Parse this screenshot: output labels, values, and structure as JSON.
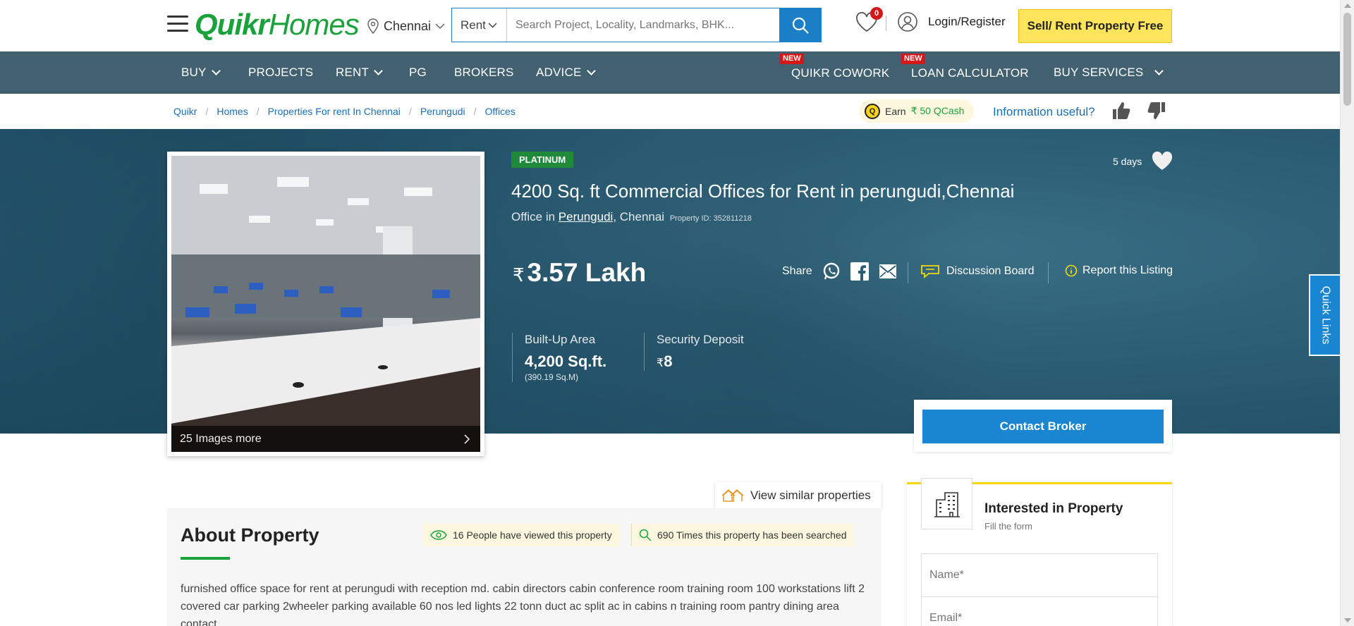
{
  "header": {
    "logo_quikr": "Quikr",
    "logo_homes": "Homes",
    "city": "Chennai",
    "search_mode": "Rent",
    "search_placeholder": "Search Project, Locality, Landmarks, BHK...",
    "wishlist_count": "0",
    "login_label": "Login/Register",
    "sell_button": "Sell/ Rent Property Free"
  },
  "nav": {
    "buy": "BUY",
    "projects": "PROJECTS",
    "rent": "RENT",
    "pg": "PG",
    "brokers": "BROKERS",
    "advice": "ADVICE",
    "cowork": "QUIKR COWORK",
    "loan": "LOAN CALCULATOR",
    "services": "BUY SERVICES",
    "new_tag": "NEW"
  },
  "breadcrumb": [
    "Quikr",
    "Homes",
    "Properties For rent In Chennai",
    "Perungudi",
    "Offices"
  ],
  "feedback": {
    "earn_prefix": "Earn",
    "earn_amount": "₹ 50 QCash",
    "coin_letter": "Q",
    "question": "Information useful?"
  },
  "listing": {
    "badge": "PLATINUM",
    "posted": "5 days",
    "title": "4200 Sq. ft Commercial Offices for Rent in perungudi,Chennai",
    "subtitle_prefix": "Office in",
    "locality": "Perungudi",
    "city": ", Chennai",
    "property_id": "Property ID: 352811218",
    "currency": "₹",
    "price": "3.57 Lakh",
    "share_label": "Share",
    "discussion": "Discussion Board",
    "report": "Report this Listing",
    "built_up_label": "Built-Up Area",
    "built_up_value": "4,200 Sq.ft.",
    "built_up_sub": "(390.19 Sq.M)",
    "deposit_label": "Security Deposit",
    "deposit_value": "8",
    "images_more": "25 Images more",
    "contact_button": "Contact Broker"
  },
  "quick_links": "Quick Links",
  "content": {
    "similar": "View similar properties",
    "about_title": "About Property",
    "viewed": "16 People have viewed this property",
    "searched": "690 Times this property has been searched",
    "description": "furnished office space for rent at perungudi with reception md. cabin directors cabin conference room training room 100 workstations lift 2 covered car parking 2wheeler parking available 60 nos led lights 22 tonn duct ac split ac in cabins n training room pantry dining area contact"
  },
  "form": {
    "title": "Interested in Property",
    "subtitle": "Fill the form",
    "name_placeholder": "Name*",
    "email_placeholder": "Email*"
  },
  "colors": {
    "brand_green": "#1aa23a",
    "nav_bg": "#426170",
    "primary_blue": "#1a86d1",
    "sell_yellow": "#ffe45c"
  }
}
